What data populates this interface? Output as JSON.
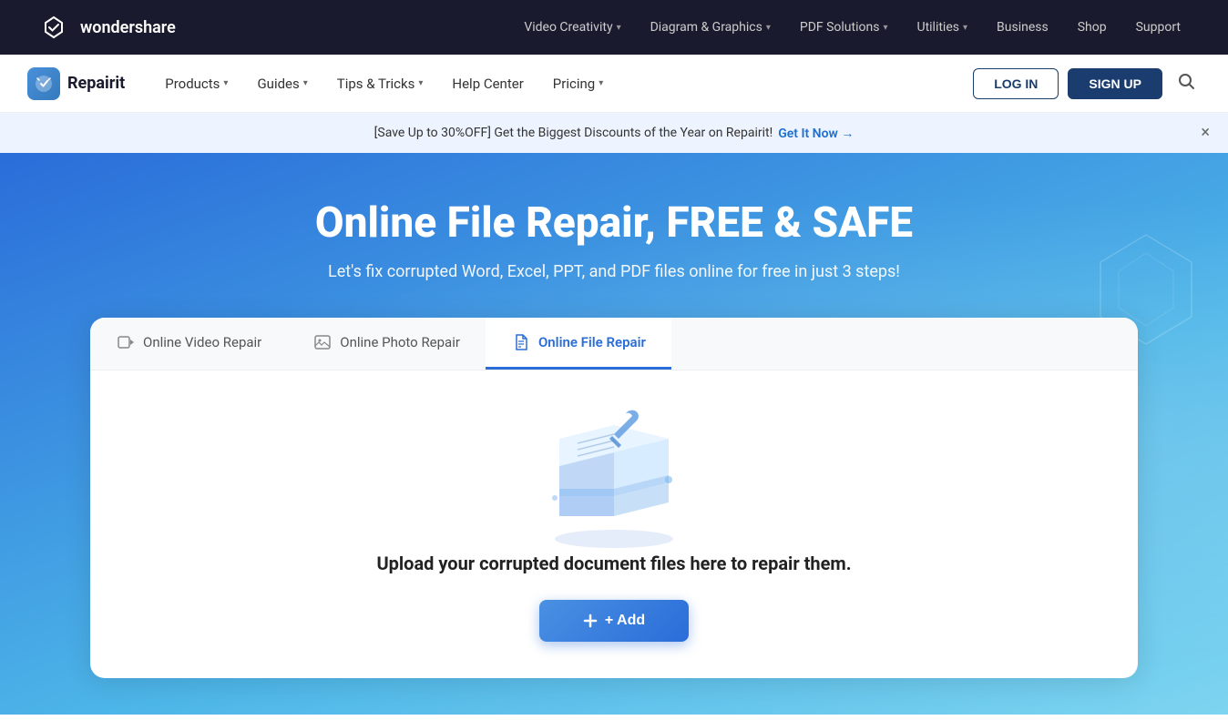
{
  "top_nav": {
    "logo_text": "wondershare",
    "links": [
      {
        "id": "video-creativity",
        "label": "Video Creativity",
        "has_chevron": true
      },
      {
        "id": "diagram-graphics",
        "label": "Diagram & Graphics",
        "has_chevron": true
      },
      {
        "id": "pdf-solutions",
        "label": "PDF Solutions",
        "has_chevron": true
      },
      {
        "id": "utilities",
        "label": "Utilities",
        "has_chevron": true
      },
      {
        "id": "business",
        "label": "Business",
        "has_chevron": false
      },
      {
        "id": "shop",
        "label": "Shop",
        "has_chevron": false
      },
      {
        "id": "support",
        "label": "Support",
        "has_chevron": false
      }
    ]
  },
  "sub_nav": {
    "brand_name": "Repairit",
    "links": [
      {
        "id": "products",
        "label": "Products",
        "has_chevron": true
      },
      {
        "id": "guides",
        "label": "Guides",
        "has_chevron": true
      },
      {
        "id": "tips-tricks",
        "label": "Tips & Tricks",
        "has_chevron": true
      },
      {
        "id": "help-center",
        "label": "Help Center",
        "has_chevron": false
      },
      {
        "id": "pricing",
        "label": "Pricing",
        "has_chevron": true
      }
    ],
    "login_label": "LOG IN",
    "signup_label": "SIGN UP"
  },
  "banner": {
    "text": "[Save Up to 30%OFF] Get the Biggest Discounts of the Year on Repairit!",
    "link_text": "Get It Now →"
  },
  "hero": {
    "title": "Online File Repair, FREE & SAFE",
    "subtitle": "Let's fix corrupted Word, Excel, PPT, and PDF files online for free in just 3 steps!"
  },
  "repair_card": {
    "tabs": [
      {
        "id": "video",
        "label": "Online Video Repair",
        "icon": "🎥",
        "active": false
      },
      {
        "id": "photo",
        "label": "Online Photo Repair",
        "icon": "🖼",
        "active": false
      },
      {
        "id": "file",
        "label": "Online File Repair",
        "icon": "📄",
        "active": true
      }
    ],
    "content": {
      "upload_text": "Upload your corrupted document files here to repair them.",
      "add_button_label": "+ Add"
    }
  }
}
